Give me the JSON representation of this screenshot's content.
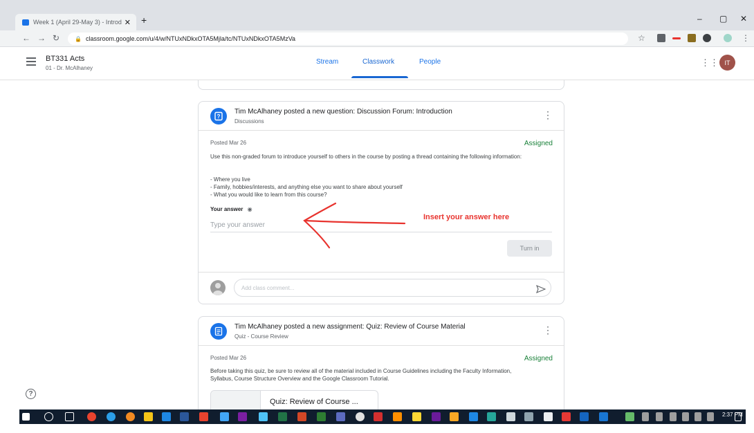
{
  "browser": {
    "tab_title": "Week 1 (April 29-May 3) - Introd",
    "tab_close": "✕",
    "new_tab": "+",
    "url": "classroom.google.com/u/4/w/NTUxNDkxOTA5Mjla/tc/NTUxNDkxOTA5MzVa",
    "minimize": "–",
    "maximize": "▢",
    "close": "✕"
  },
  "header": {
    "class_name": "BT331 Acts",
    "section": "01 - Dr. McAlhaney",
    "tabs": [
      {
        "label": "Stream"
      },
      {
        "label": "Classwork"
      },
      {
        "label": "People"
      }
    ],
    "active_tab": "Classwork",
    "avatar_initials": "IT"
  },
  "question_card": {
    "title": "Tim McAlhaney posted a new question: Discussion Forum: Introduction",
    "topic": "Discussions",
    "posted": "Posted Mar 26",
    "status": "Assigned",
    "description": "Use this non-graded forum to introduce yourself to others in the course by posting a thread containing the following information:",
    "bullets": [
      "- Where you live",
      "- Family, hobbies/interests, and anything else you want to share about yourself",
      "- What you would like to learn from this course?"
    ],
    "your_answer_label": "Your answer",
    "answer_placeholder": "Type your answer",
    "turn_in_label": "Turn in",
    "comment_placeholder": "Add class comment..."
  },
  "annotation": {
    "text": "Insert your answer here",
    "color": "#e8332e"
  },
  "quiz_card": {
    "title": "Tim McAlhaney posted a new assignment: Quiz: Review of Course Material",
    "topic": "Quiz - Course Review",
    "posted": "Posted Mar 26",
    "status": "Assigned",
    "description": "Before taking this quiz, be sure to review all of the material included in Course Guidelines including the Faculty Information, Syllabus, Course Structure Overview and the Google Classroom Tutorial.",
    "attachment_title": "Quiz: Review of Course ..."
  },
  "help_label": "?",
  "taskbar": {
    "time": "2:37 PM"
  },
  "colors": {
    "accent": "#1967d2",
    "assigned": "#188038",
    "taskbar": "#101d2e"
  }
}
